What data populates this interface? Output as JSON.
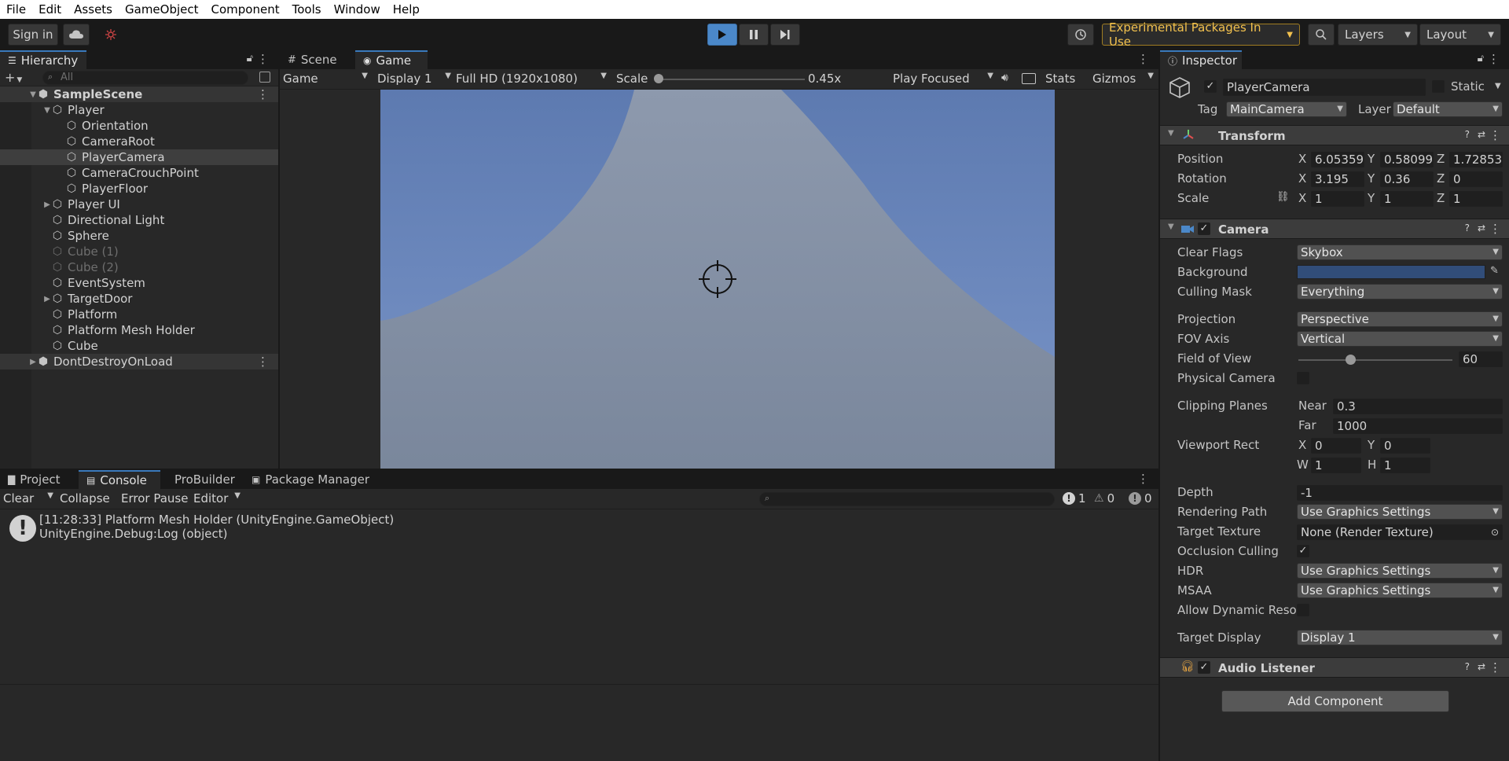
{
  "menu": [
    "File",
    "Edit",
    "Assets",
    "GameObject",
    "Component",
    "Tools",
    "Window",
    "Help"
  ],
  "toolbar": {
    "sign_in": "Sign in",
    "experimental": "Experimental Packages In Use",
    "layers": "Layers",
    "layout": "Layout",
    "accent": "#4b88c9"
  },
  "hierarchy": {
    "title": "Hierarchy",
    "search_placeholder": "All",
    "items": [
      {
        "label": "SampleScene",
        "indent": 0,
        "kind": "scene",
        "arrow": "down"
      },
      {
        "label": "Player",
        "indent": 1,
        "kind": "obj",
        "arrow": "down"
      },
      {
        "label": "Orientation",
        "indent": 2,
        "kind": "obj",
        "arrow": ""
      },
      {
        "label": "CameraRoot",
        "indent": 2,
        "kind": "obj",
        "arrow": ""
      },
      {
        "label": "PlayerCamera",
        "indent": 2,
        "kind": "obj",
        "arrow": "",
        "selected": true
      },
      {
        "label": "CameraCrouchPoint",
        "indent": 2,
        "kind": "obj",
        "arrow": ""
      },
      {
        "label": "PlayerFloor",
        "indent": 2,
        "kind": "obj",
        "arrow": ""
      },
      {
        "label": "Player UI",
        "indent": 1,
        "kind": "obj",
        "arrow": "right"
      },
      {
        "label": "Directional Light",
        "indent": 1,
        "kind": "obj",
        "arrow": ""
      },
      {
        "label": "Sphere",
        "indent": 1,
        "kind": "obj",
        "arrow": ""
      },
      {
        "label": "Cube (1)",
        "indent": 1,
        "kind": "obj",
        "arrow": "",
        "disabled": true
      },
      {
        "label": "Cube (2)",
        "indent": 1,
        "kind": "obj",
        "arrow": "",
        "disabled": true
      },
      {
        "label": "EventSystem",
        "indent": 1,
        "kind": "obj",
        "arrow": ""
      },
      {
        "label": "TargetDoor",
        "indent": 1,
        "kind": "obj",
        "arrow": "right"
      },
      {
        "label": "Platform",
        "indent": 1,
        "kind": "obj",
        "arrow": ""
      },
      {
        "label": "Platform Mesh Holder",
        "indent": 1,
        "kind": "obj",
        "arrow": ""
      },
      {
        "label": "Cube",
        "indent": 1,
        "kind": "obj",
        "arrow": ""
      },
      {
        "label": "DontDestroyOnLoad",
        "indent": 0,
        "kind": "scene",
        "arrow": "right"
      }
    ]
  },
  "game": {
    "tabs": [
      "Scene",
      "Game"
    ],
    "mode": "Game",
    "display": "Display 1",
    "resolution": "Full HD (1920x1080)",
    "scale_label": "Scale",
    "scale_value": "0.45x",
    "play_focused": "Play Focused",
    "stats": "Stats",
    "gizmos": "Gizmos"
  },
  "console": {
    "tabs": [
      "Project",
      "Console",
      "ProBuilder",
      "Package Manager"
    ],
    "clear": "Clear",
    "collapse": "Collapse",
    "error_pause": "Error Pause",
    "editor": "Editor",
    "count_log": "1",
    "count_warn": "0",
    "count_err": "0",
    "log_line1": "[11:28:33] Platform Mesh Holder (UnityEngine.GameObject)",
    "log_line2": "UnityEngine.Debug:Log (object)"
  },
  "inspector": {
    "title": "Inspector",
    "object_name": "PlayerCamera",
    "static_label": "Static",
    "tag_label": "Tag",
    "tag_value": "MainCamera",
    "layer_label": "Layer",
    "layer_value": "Default",
    "transform": {
      "title": "Transform",
      "position_label": "Position",
      "rotation_label": "Rotation",
      "scale_label": "Scale",
      "pos": [
        "6.05359",
        "0.58099",
        "1.72853"
      ],
      "rot": [
        "3.195",
        "0.36",
        "0"
      ],
      "scl": [
        "1",
        "1",
        "1"
      ]
    },
    "camera": {
      "title": "Camera",
      "clear_flags_label": "Clear Flags",
      "clear_flags": "Skybox",
      "background_label": "Background",
      "background_color": "#314d79",
      "culling_mask_label": "Culling Mask",
      "culling_mask": "Everything",
      "projection_label": "Projection",
      "projection": "Perspective",
      "fov_axis_label": "FOV Axis",
      "fov_axis": "Vertical",
      "fov_label": "Field of View",
      "fov": "60",
      "physical_label": "Physical Camera",
      "clipping_label": "Clipping Planes",
      "near_label": "Near",
      "near": "0.3",
      "far_label": "Far",
      "far": "1000",
      "viewport_label": "Viewport Rect",
      "vx": "0",
      "vy": "0",
      "vw": "1",
      "vh": "1",
      "depth_label": "Depth",
      "depth": "-1",
      "rendering_path_label": "Rendering Path",
      "rendering_path": "Use Graphics Settings",
      "target_texture_label": "Target Texture",
      "target_texture": "None (Render Texture)",
      "occlusion_label": "Occlusion Culling",
      "hdr_label": "HDR",
      "hdr": "Use Graphics Settings",
      "msaa_label": "MSAA",
      "msaa": "Use Graphics Settings",
      "dynres_label": "Allow Dynamic Reso",
      "target_display_label": "Target Display",
      "target_display": "Display 1"
    },
    "audio_listener": "Audio Listener",
    "add_component": "Add Component"
  }
}
